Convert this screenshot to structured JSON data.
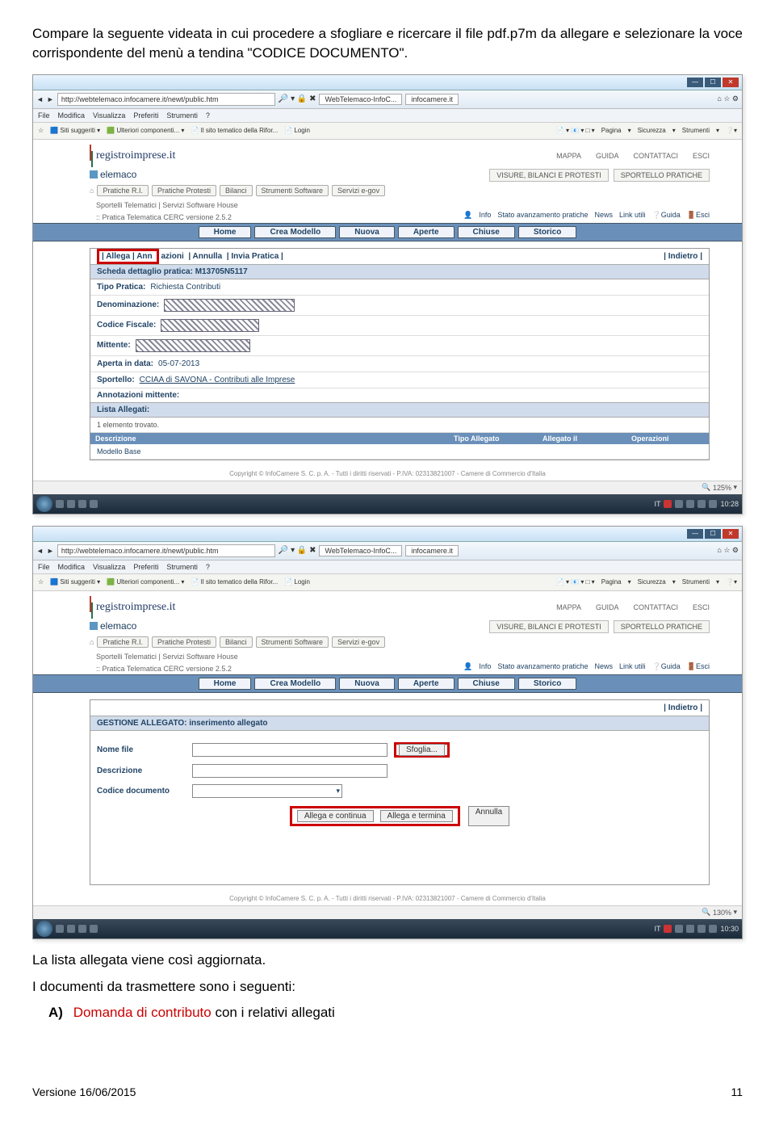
{
  "intro": "Compare la seguente videata in cui procedere a sfogliare e ricercare il file pdf.p7m da allegare e selezionare la voce corrispondente del menù a tendina \"CODICE DOCUMENTO\".",
  "browser": {
    "url": "http://webtelemaco.infocamere.it/newt/public.htm",
    "tabs": [
      "WebTelemaco-InfoC...",
      "infocamere.it"
    ],
    "menus": [
      "File",
      "Modifica",
      "Visualizza",
      "Preferiti",
      "Strumenti",
      "?"
    ],
    "favleft": [
      "Siti suggeriti",
      "Ulteriori componenti...",
      "Il sito tematico della Rifor...",
      "Login"
    ],
    "favright": [
      "Pagina",
      "Sicurezza",
      "Strumenti"
    ],
    "zoom1": "125%",
    "zoom2": "130%",
    "time1": "10:28",
    "time2": "10:30",
    "lang": "IT"
  },
  "site": {
    "title": "registroimprese.it",
    "telemaco": "elemaco",
    "toplinks": [
      "MAPPA",
      "GUIDA",
      "CONTATTACI",
      "ESCI"
    ],
    "toptabs": [
      "VISURE, BILANCI E PROTESTI",
      "SPORTELLO PRATICHE"
    ],
    "navpills": [
      "Pratiche R.I.",
      "Pratiche Protesti",
      "Bilanci",
      "Strumenti Software",
      "Servizi e-gov"
    ],
    "sub1": "Sportelli Telematici | Servizi Software House",
    "sub2": ":: Pratica Telematica CERC versione 2.5.2",
    "info": [
      "Info",
      "Stato avanzamento pratiche",
      "News",
      "Link utili",
      "Guida",
      "Esci"
    ],
    "bluetabs": [
      "Home",
      "Crea Modello",
      "Nuova",
      "Aperte",
      "Chiuse",
      "Storico"
    ],
    "copyright": "Copyright © InfoCamere S. C. p. A. - Tutti i diritti riservati - P.IVA: 02313821007 - Camere di Commercio d'Italia"
  },
  "pratica": {
    "actions": [
      "| Allega",
      "| Ann",
      "azioni",
      "| Annulla",
      "| Invia Pratica |"
    ],
    "back": "| Indietro |",
    "title": "Scheda dettaglio pratica: M13705N5117",
    "tipo_label": "Tipo Pratica:",
    "tipo_value": "Richiesta Contributi",
    "denom_label": "Denominazione:",
    "cf_label": "Codice Fiscale:",
    "mitt_label": "Mittente:",
    "aperta_label": "Aperta in data:",
    "aperta_value": "05-07-2013",
    "sportello_label": "Sportello:",
    "sportello_value": "CCIAA di SAVONA - Contributi alle Imprese",
    "annot_label": "Annotazioni mittente:",
    "lista_label": "Lista Allegati:",
    "trovato": "1 elemento trovato.",
    "tcol1": "Descrizione",
    "tcol2": "Tipo Allegato",
    "tcol3": "Allegato il",
    "tcol4": "Operazioni",
    "row1": "Modello Base"
  },
  "form": {
    "title": "GESTIONE ALLEGATO: inserimento allegato",
    "nome": "Nome file",
    "descr": "Descrizione",
    "codice": "Codice documento",
    "sfoglia": "Sfoglia...",
    "b1": "Allega e continua",
    "b2": "Allega e termina",
    "b3": "Annulla",
    "back": "| Indietro |"
  },
  "outro1": "La lista allegata viene così aggiornata.",
  "outro2": "I documenti da trasmettere sono i seguenti:",
  "list": {
    "marker": "A)",
    "red": "Domanda di contributo",
    "rest": " con i relativi allegati"
  },
  "footer_left": "Versione 16/06/2015",
  "footer_right": "11"
}
